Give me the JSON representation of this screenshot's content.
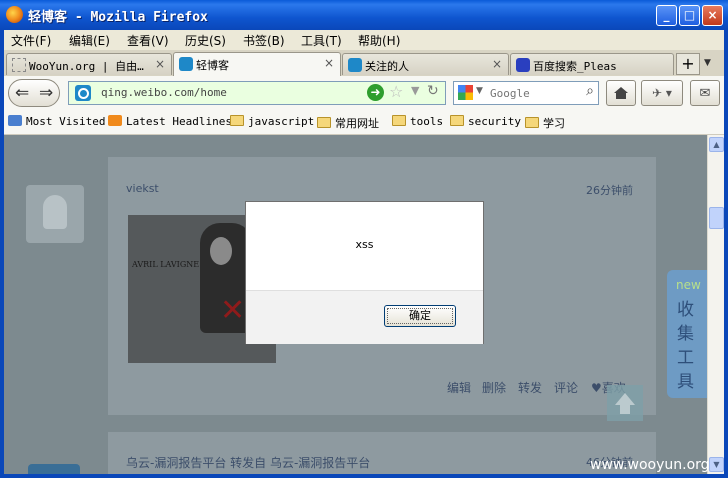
{
  "window": {
    "title": "轻博客 - Mozilla Firefox",
    "controls": {
      "minimize": "_",
      "maximize": "□",
      "close": "×"
    }
  },
  "menu": [
    "文件(F)",
    "编辑(E)",
    "查看(V)",
    "历史(S)",
    "书签(B)",
    "工具(T)",
    "帮助(H)"
  ],
  "tabs": [
    {
      "label": "WooYun.org | 自由…",
      "close": "×",
      "active": false
    },
    {
      "label": "轻博客",
      "close": "×",
      "active": true
    },
    {
      "label": "关注的人",
      "close": "×",
      "active": false
    },
    {
      "label": "百度搜索_Pleas",
      "close": "×",
      "active": false
    }
  ],
  "newtab_label": "+",
  "nav": {
    "url": "qing.weibo.com/home",
    "search_placeholder": "Google"
  },
  "bookmarks": [
    "Most Visited",
    "Latest Headlines",
    "javascript",
    "常用网址",
    "tools",
    "security",
    "学习"
  ],
  "post": {
    "author": "viekst",
    "time": "26分钟前",
    "album_text": "AVRIL LAVIGNE",
    "actions": [
      "编辑",
      "删除",
      "转发",
      "评论",
      "喜欢"
    ]
  },
  "post2": {
    "source": "乌云-漏洞报告平台 转发自 乌云-漏洞报告平台",
    "time": "46分钟前"
  },
  "side_widget": {
    "badge": "new",
    "text": "收集工具"
  },
  "dialog": {
    "message": "xss",
    "ok_label": "确定"
  },
  "watermark": "www.wooyun.org",
  "colors": {
    "titlebar": "#0a5bd8",
    "url_secure": "#eaffe0",
    "overlay": "#7f8b8f"
  }
}
